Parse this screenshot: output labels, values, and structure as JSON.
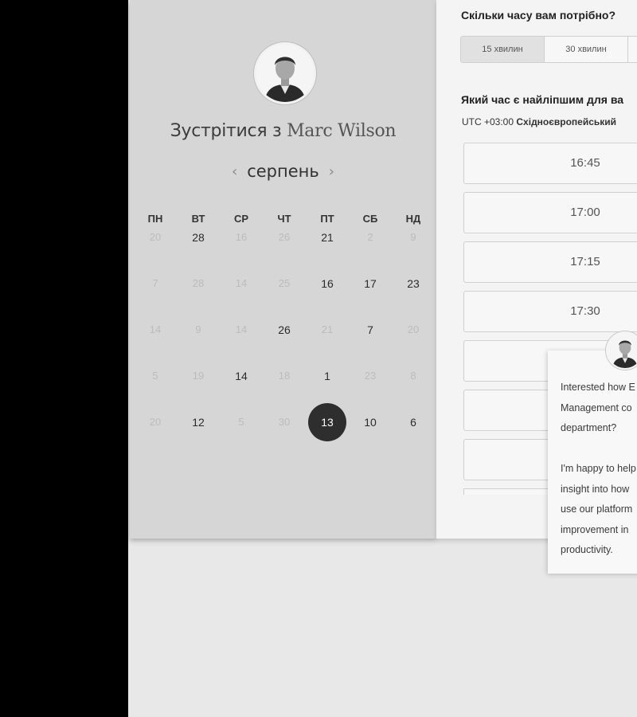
{
  "host": {
    "prefix": "Зустрітися з",
    "name": "Marc Wilson"
  },
  "calendar": {
    "month": "серпень",
    "prev_icon": "‹",
    "next_icon": "›",
    "weekdays": [
      "ПН",
      "ВТ",
      "СР",
      "ЧТ",
      "ПТ",
      "СБ",
      "НД"
    ],
    "weeks": [
      [
        {
          "d": "20",
          "a": false
        },
        {
          "d": "28",
          "a": true
        },
        {
          "d": "16",
          "a": false
        },
        {
          "d": "26",
          "a": false
        },
        {
          "d": "21",
          "a": true
        },
        {
          "d": "2",
          "a": false
        },
        {
          "d": "9",
          "a": false
        }
      ],
      [
        {
          "d": "7",
          "a": false
        },
        {
          "d": "28",
          "a": false
        },
        {
          "d": "14",
          "a": false
        },
        {
          "d": "25",
          "a": false
        },
        {
          "d": "16",
          "a": true
        },
        {
          "d": "17",
          "a": true
        },
        {
          "d": "23",
          "a": true
        }
      ],
      [
        {
          "d": "14",
          "a": false
        },
        {
          "d": "9",
          "a": false
        },
        {
          "d": "14",
          "a": false
        },
        {
          "d": "26",
          "a": true
        },
        {
          "d": "21",
          "a": false
        },
        {
          "d": "7",
          "a": true
        },
        {
          "d": "20",
          "a": false
        }
      ],
      [
        {
          "d": "5",
          "a": false
        },
        {
          "d": "19",
          "a": false
        },
        {
          "d": "14",
          "a": true
        },
        {
          "d": "18",
          "a": false
        },
        {
          "d": "1",
          "a": true
        },
        {
          "d": "23",
          "a": false
        },
        {
          "d": "8",
          "a": false
        }
      ],
      [
        {
          "d": "20",
          "a": false
        },
        {
          "d": "12",
          "a": true
        },
        {
          "d": "5",
          "a": false
        },
        {
          "d": "30",
          "a": false
        },
        {
          "d": "13",
          "a": true,
          "s": true
        },
        {
          "d": "10",
          "a": true
        },
        {
          "d": "6",
          "a": true
        }
      ]
    ]
  },
  "duration": {
    "question": "Скільки часу вам потрібно?",
    "options": [
      "15 хвилин",
      "30 хвилин",
      ""
    ],
    "selected": 0
  },
  "time": {
    "question": "Який час є найліпшим для ва",
    "tz_offset": "UTC +03:00",
    "tz_name": "Східноєвропейський",
    "slots": [
      "16:45",
      "17:00",
      "17:15",
      "17:30",
      "",
      "",
      ""
    ]
  },
  "chat": {
    "lines_a": [
      "Interested how E",
      "Management co",
      "department?"
    ],
    "lines_b": [
      "I'm happy to help",
      "insight into how",
      "use our platform",
      "improvement in",
      "productivity."
    ]
  },
  "colors": {
    "selected_day": "#2e2e2e",
    "left_panel": "#d6d6d6",
    "right_panel": "#f4f4f4"
  }
}
